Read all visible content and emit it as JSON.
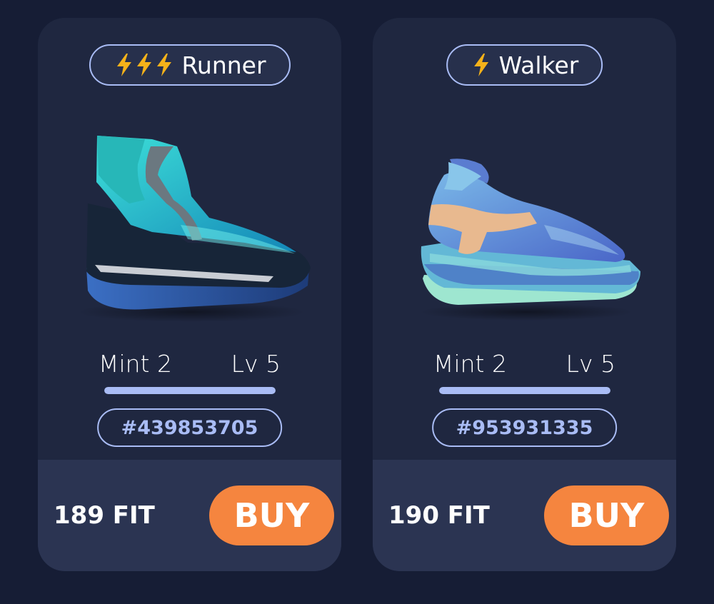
{
  "colors": {
    "background": "#161d35",
    "card": "#1f2740",
    "card_footer": "#2b3452",
    "accent": "#a9bcf5",
    "buy_button": "#f5853f",
    "bolt": "#f5b21a"
  },
  "cards": [
    {
      "type_label": "Runner",
      "bolt_count": 3,
      "image_icon": "sneaker-teal-image",
      "mint_label": "Mint 2",
      "level_label": "Lv 5",
      "level_progress": 1.0,
      "id_label": "#439853705",
      "price_label": "189 FIT",
      "buy_label": "BUY"
    },
    {
      "type_label": "Walker",
      "bolt_count": 1,
      "image_icon": "sneaker-blue-image",
      "mint_label": "Mint 2",
      "level_label": "Lv 5",
      "level_progress": 1.0,
      "id_label": "#953931335",
      "price_label": "190 FIT",
      "buy_label": "BUY"
    }
  ]
}
